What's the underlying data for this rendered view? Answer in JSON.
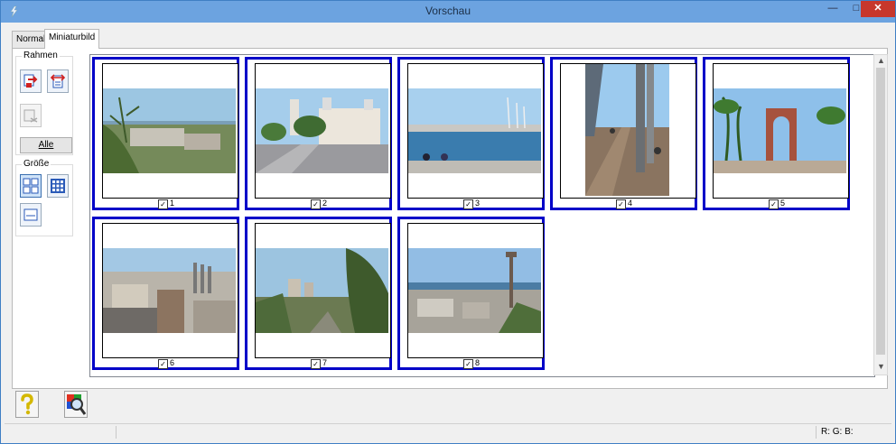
{
  "window": {
    "title": "Vorschau"
  },
  "tabs": [
    {
      "label": "Normal"
    },
    {
      "label": "Miniaturbild"
    }
  ],
  "sidebar": {
    "frame_group": {
      "legend": "Rahmen",
      "all_label": "Alle"
    },
    "size_group": {
      "legend": "Größe"
    }
  },
  "thumbnails": [
    {
      "number": "1",
      "checked": true
    },
    {
      "number": "2",
      "checked": true
    },
    {
      "number": "3",
      "checked": true
    },
    {
      "number": "4",
      "checked": true
    },
    {
      "number": "5",
      "checked": true
    },
    {
      "number": "6",
      "checked": true
    },
    {
      "number": "7",
      "checked": true
    },
    {
      "number": "8",
      "checked": true
    }
  ],
  "statusbar": {
    "rgb": "R: G: B:"
  },
  "colors": {
    "selection_border": "#0000c8",
    "titlebar": "#6ca3e0",
    "close_button": "#c7372c"
  },
  "icons": {
    "help": "question-mark-icon",
    "preview_zoom": "magnifier-icon"
  }
}
